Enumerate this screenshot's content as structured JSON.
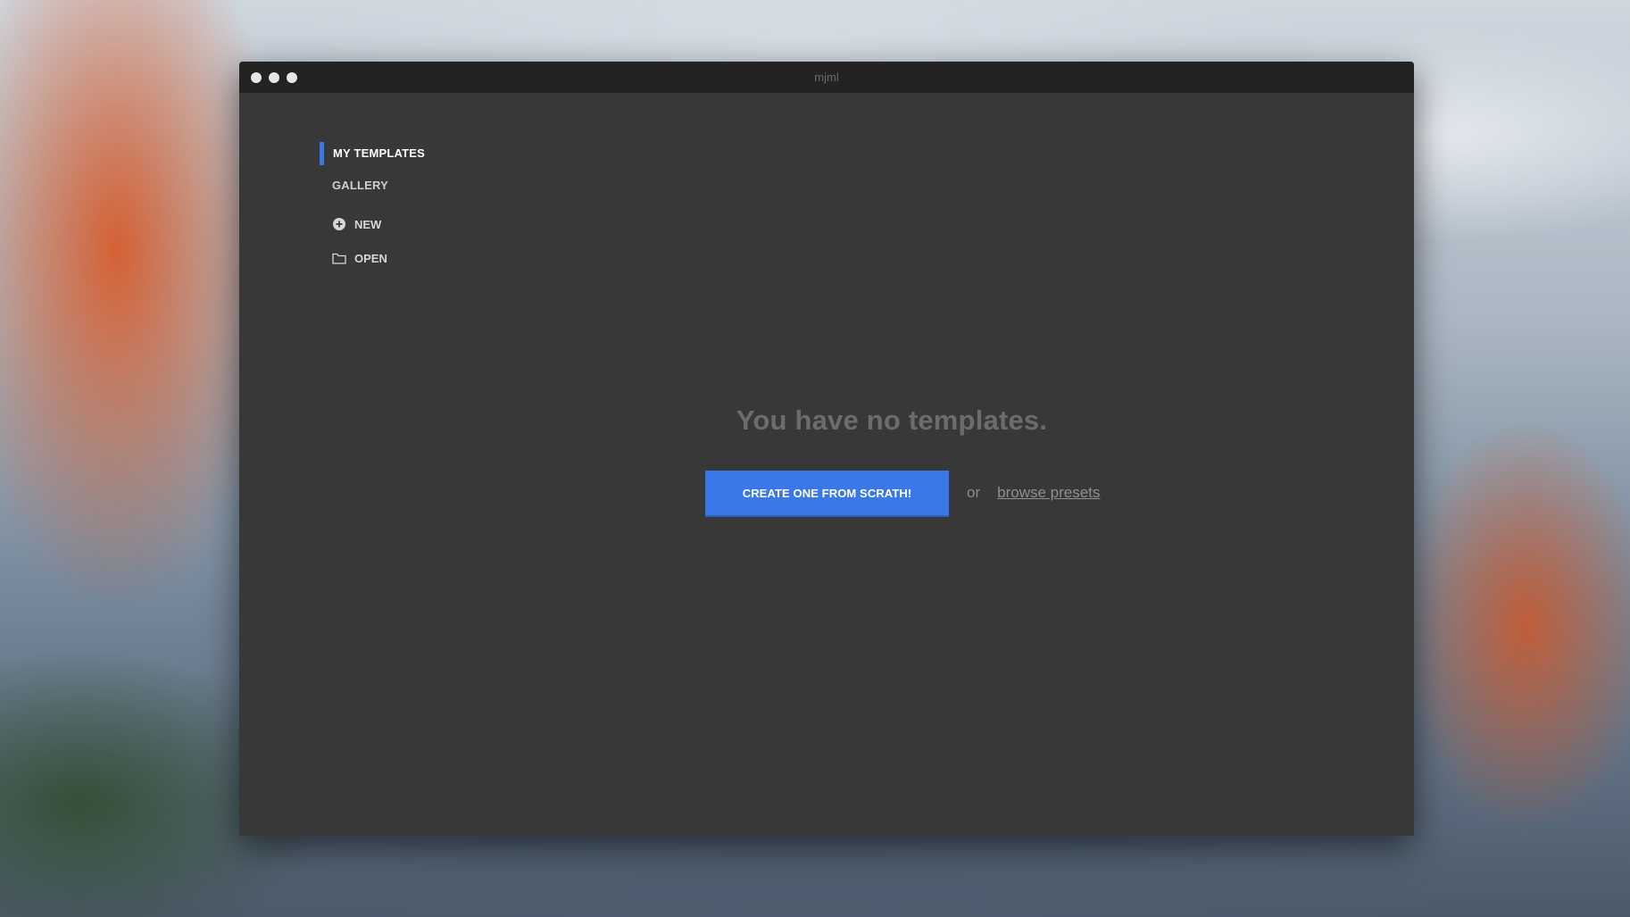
{
  "window": {
    "title": "mjml"
  },
  "sidebar": {
    "items": [
      {
        "label": "MY TEMPLATES",
        "active": true
      },
      {
        "label": "GALLERY",
        "active": false
      }
    ],
    "actions": {
      "new_label": "NEW",
      "new_icon": "plus-circle-icon",
      "open_label": "OPEN",
      "open_icon": "folder-icon"
    }
  },
  "main": {
    "empty_title": "You have no templates.",
    "create_button_label": "CREATE ONE FROM SCRATH!",
    "or_text": "or",
    "browse_link": "browse presets"
  },
  "colors": {
    "accent": "#3b78e7",
    "window_bg": "#383838",
    "titlebar_bg": "#232323"
  }
}
